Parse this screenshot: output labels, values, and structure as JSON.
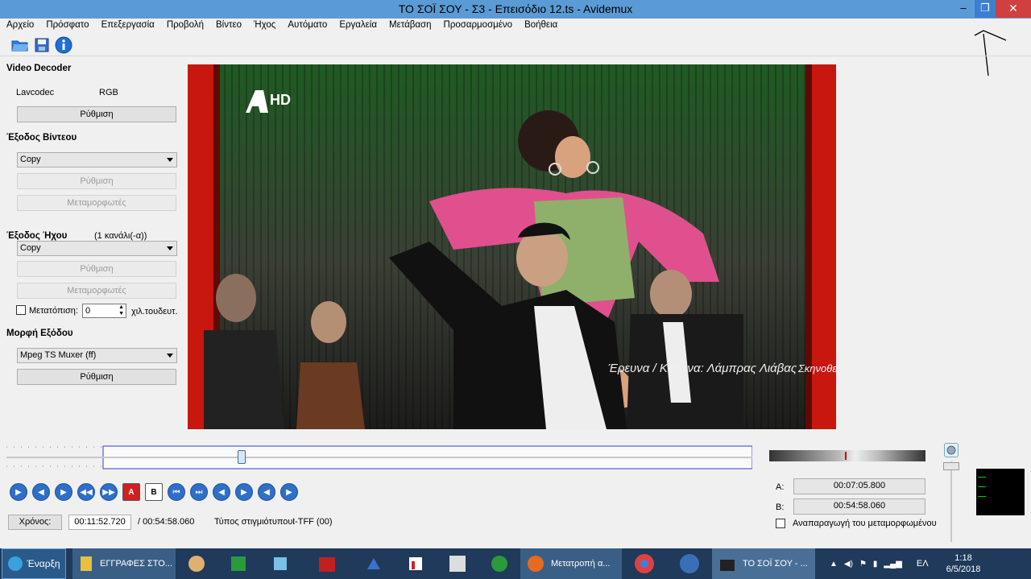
{
  "window": {
    "title": "ΤΟ ΣΟΪ ΣΟΥ - Σ3 - Επεισόδιο 12.ts - Avidemux",
    "minimize": "–",
    "restore": "❐",
    "close": "✕"
  },
  "menu": [
    "Αρχείο",
    "Πρόσφατο",
    "Επεξεργασία",
    "Προβολή",
    "Βίντεο",
    "Ήχος",
    "Αυτόματο",
    "Εργαλεία",
    "Μετάβαση",
    "Προσαρμοσμένο",
    "Βοήθεια"
  ],
  "toolbar": {
    "icons": [
      "open-folder-icon",
      "save-floppy-icon",
      "info-icon"
    ]
  },
  "video_decoder": {
    "title": "Video Decoder",
    "codec": "Lavcodec",
    "colorspace": "RGB",
    "config_button": "Ρύθμιση"
  },
  "video_output": {
    "title": "Έξοδος Βίντεου",
    "selected": "Copy",
    "config_button": "Ρύθμιση",
    "filters_button": "Μεταμορφωτές"
  },
  "audio_output": {
    "title": "Έξοδος Ήχου",
    "channels": "(1 κανάλι(-α))",
    "selected": "Copy",
    "config_button": "Ρύθμιση",
    "filters_button": "Μεταμορφωτές",
    "shift_label": "Μετατόπιση:",
    "shift_value": "0",
    "shift_unit": "χιλ.τουδευτ."
  },
  "output_format": {
    "title": "Μορφή Εξόδου",
    "selected": "Mpeg TS Muxer (ff)",
    "config_button": "Ρύθμιση"
  },
  "video_overlay": {
    "channel_logo": "HD",
    "credits": "Έρευνα / Κείμενα: Λάμπρας Λιάβας",
    "credits2": "Σκηνοθεσ"
  },
  "playback": {
    "progress": 0.214,
    "time_button": "Χρόνος:",
    "current_time": "00:11:52.720",
    "total_time": "/ 00:54:58.060",
    "frame_type_label": "Τύπος στιγμιότυπου:",
    "frame_type": "I-TFF (00)"
  },
  "markers": {
    "a_label": "A:",
    "a_time": "00:07:05.800",
    "b_label": "B:",
    "b_time": "00:54:58.060",
    "play_filtered": "Αναπαραγωγή του μεταμορφωμένου"
  },
  "controls": [
    "play",
    "prev-frame",
    "next-frame",
    "prev-keyframe",
    "next-keyframe",
    "set-marker-a",
    "set-marker-b",
    "go-start",
    "go-end",
    "prev-black",
    "next-black",
    "go-marker-a",
    "go-marker-b"
  ],
  "taskbar": {
    "start": "Έναρξη",
    "items": [
      "ΕΓΓΡΑΦΕΣ ΣΤΟ...",
      "Μετατροπή α...",
      "ΤΟ ΣΟΪ ΣΟΥ - ..."
    ],
    "lang": "ΕΛ",
    "clock_time": "1:18",
    "clock_date": "6/5/2018"
  }
}
